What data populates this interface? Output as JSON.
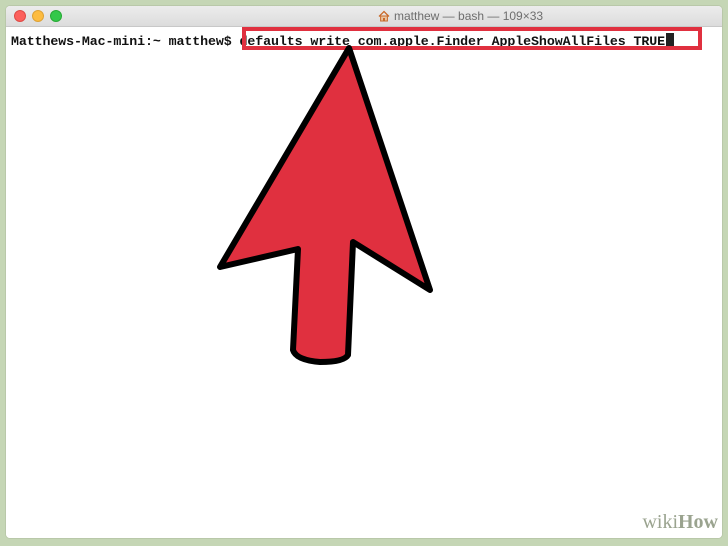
{
  "window": {
    "title": "matthew — bash — 109×33"
  },
  "terminal": {
    "prompt": "Matthews-Mac-mini:~ matthew$ ",
    "command": "defaults write com.apple.Finder AppleShowAllFiles TRUE"
  },
  "watermark": {
    "prefix": "wiki",
    "suffix": "How"
  },
  "colors": {
    "highlight": "#e0303f",
    "arrow_fill": "#e0303f"
  },
  "icons": {
    "title": "home-icon",
    "annotation": "arrow-icon"
  }
}
